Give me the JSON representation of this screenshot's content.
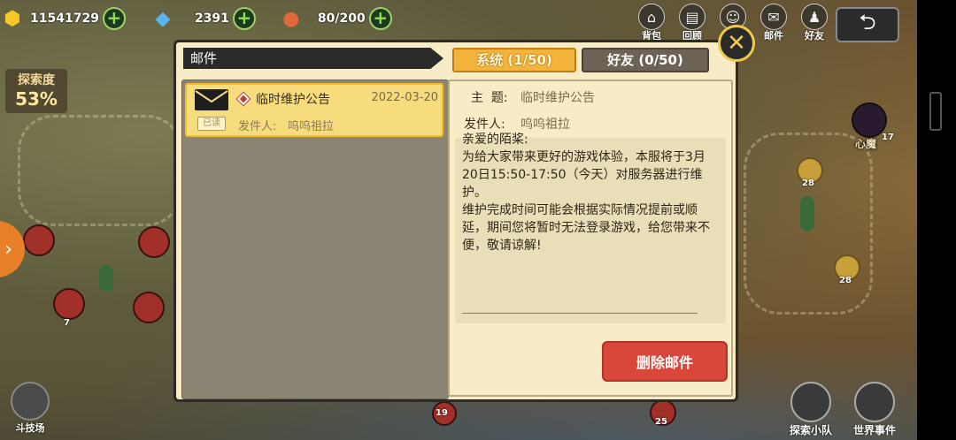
{
  "resources": {
    "gold": "11541729",
    "diamond": "2391",
    "stamina": "80/200"
  },
  "top_buttons": [
    "背包",
    "回顾",
    "",
    "邮件",
    "好友"
  ],
  "explore": {
    "label": "探索度",
    "value": "53%"
  },
  "map_labels": {
    "label_1": "心魔",
    "label_2": "斗技场",
    "num_17": "17",
    "num_28a": "28",
    "num_28b": "28",
    "num_7": "7",
    "num_19": "19",
    "num_25": "25"
  },
  "bottom_buttons": {
    "team": "探索小队",
    "world": "世界事件"
  },
  "mail": {
    "title": "邮件",
    "tabs": {
      "system": "系统 (1/50)",
      "friends": "好友 (0/50)"
    },
    "items": [
      {
        "subject": "临时维护公告",
        "date": "2022-03-20",
        "from_label": "发件人:",
        "from": "呜呜祖拉",
        "status": "已读"
      }
    ],
    "detail": {
      "subject_label": "主  题:",
      "subject": "临时维护公告",
      "from_label": "发件人:",
      "from": "呜呜祖拉",
      "body": "亲爱的陌桨:\n为给大家带来更好的游戏体验，本服将于3月20日15:50-17:50（今天）对服务器进行维护。\n维护完成时间可能会根据实际情况提前或顺延，期间您将暂时无法登录游戏，给您带来不便，敬请谅解!"
    },
    "delete_label": "删除邮件"
  },
  "colors": {
    "active_tab": "#f4b43b",
    "inactive_tab": "#6c6256",
    "delete_button": "#d9463a",
    "dialog_bg": "#f7ecc6"
  }
}
